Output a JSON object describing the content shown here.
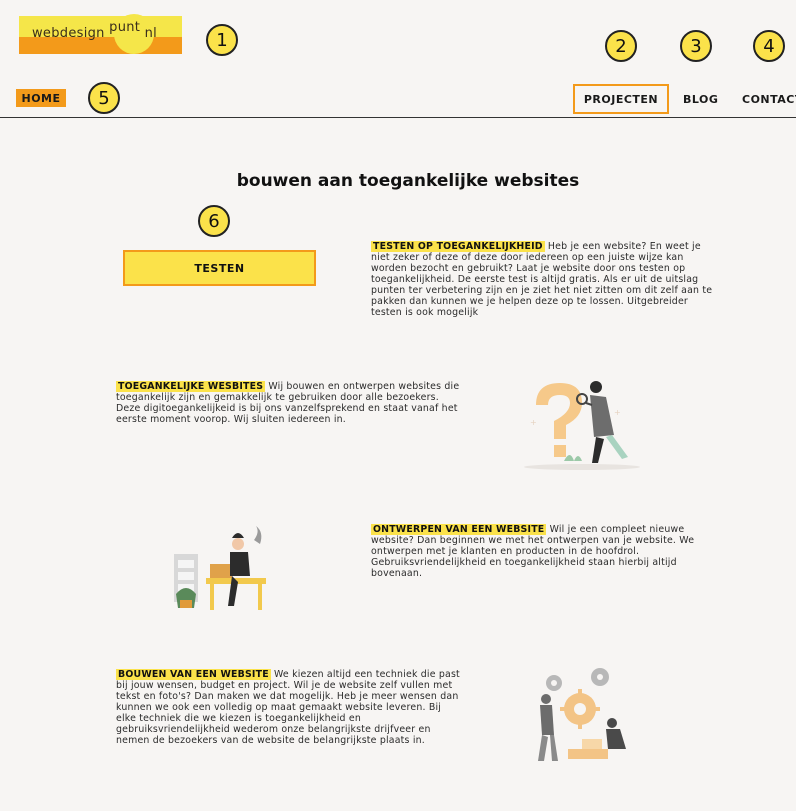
{
  "logo": {
    "part1": "webdesign",
    "part2": "punt",
    "part3": "nl"
  },
  "callouts": [
    "1",
    "2",
    "3",
    "4",
    "5",
    "6"
  ],
  "nav": {
    "home": "HOME",
    "projecten": "PROJECTEN",
    "blog": "BLOG",
    "contact": "CONTACT"
  },
  "page_title": "bouwen aan toegankelijke websites",
  "testen_button": "TESTEN",
  "sections": [
    {
      "heading": "TESTEN OP TOEGANKELIJKHEID",
      "text": " Heb je een website? En weet je niet zeker of deze of deze door iedereen op een juiste wijze kan worden bezocht en gebruikt? Laat je website door ons testen op toegankelijkheid. De eerste test is altijd gratis. Als er uit de uitslag punten ter verbetering zijn en je ziet het niet zitten om dit zelf aan te pakken dan kunnen we je helpen deze op te lossen. Uitgebreider testen is ook mogelijk"
    },
    {
      "heading": "TOEGANKELIJKE WESBITES",
      "text": " Wij bouwen en ontwerpen websites die toegankelijk zijn en gemakkelijk te gebruiken door alle bezoekers. Deze digitoegankelijkeid is bij ons vanzelfsprekend en staat vanaf het eerste moment voorop. Wij sluiten iedereen in."
    },
    {
      "heading": "ONTWERPEN VAN EEN WEBSITE",
      "text": " Wil je een compleet nieuwe website? Dan beginnen we met het ontwerpen van je website. We ontwerpen met je klanten en producten in de hoofdrol. Gebruiksvriendelijkheid en toegankelijkheid staan hierbij altijd bovenaan."
    },
    {
      "heading": "BOUWEN VAN EEN WEBSITE",
      "text": " We kiezen altijd een techniek die past bij jouw wensen, budget en project. Wil je de website zelf vullen met tekst en foto's? Dan maken we dat mogelijk. Heb je meer wensen dan kunnen we ook een volledig op maat gemaakt website leveren. Bij elke techniek die we kiezen is toegankelijkheid en gebruiksvriendelijkheid wederom onze belangrijkste drijfveer en nemen de bezoekers van de website de belangrijkste plaats in."
    }
  ],
  "icons": [
    "question-person-illustration",
    "desk-worker-illustration",
    "gears-workers-illustration"
  ]
}
